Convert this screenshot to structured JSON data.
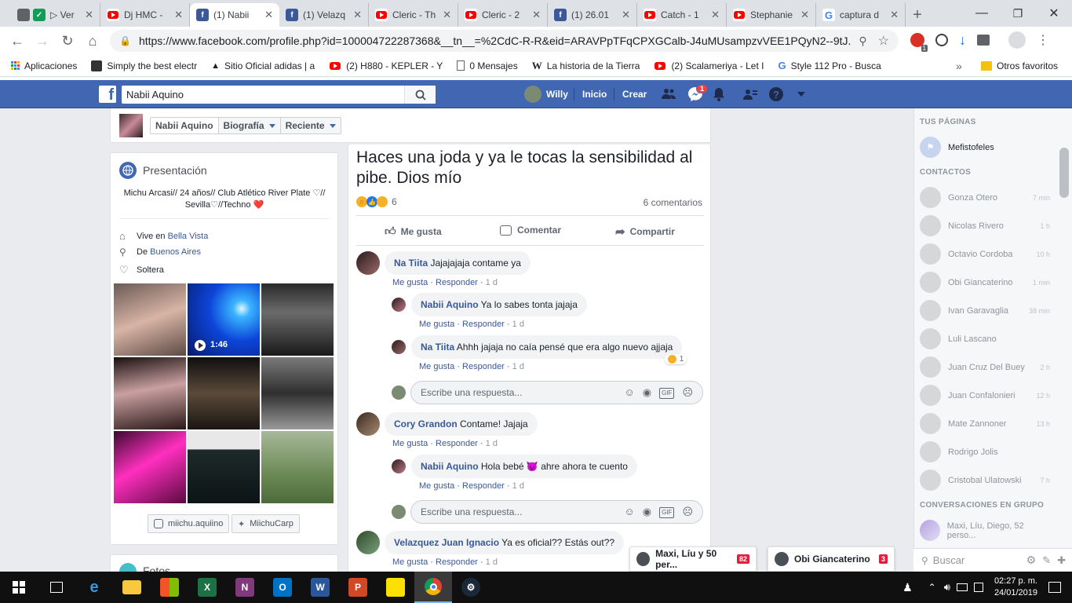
{
  "browser": {
    "tabs": [
      {
        "label": "▷ Ver",
        "icon": "video-icon"
      },
      {
        "label": "Dj HMC - ",
        "icon": "youtube-icon"
      },
      {
        "label": "(1) Nabii",
        "icon": "facebook-icon",
        "active": true
      },
      {
        "label": "(1) Velazq",
        "icon": "facebook-icon"
      },
      {
        "label": "Cleric - Th",
        "icon": "youtube-icon"
      },
      {
        "label": "Cleric - 2",
        "icon": "youtube-icon"
      },
      {
        "label": "(1) 26.01",
        "icon": "facebook-icon"
      },
      {
        "label": "Catch - 1",
        "icon": "youtube-icon"
      },
      {
        "label": "Stephanie",
        "icon": "youtube-icon"
      },
      {
        "label": "captura d",
        "icon": "google-icon"
      }
    ],
    "new_tab": "+",
    "url": "https://www.facebook.com/profile.php?id=100004722287368&__tn__=%2CdC-R-R&eid=ARAVPpTFqCPXGCalb-J4uMUsampzvVEE1PQyN2--9tJ...",
    "bookmarks": [
      {
        "label": "Aplicaciones",
        "icon": "apps-grid-icon"
      },
      {
        "label": "Simply the best electr",
        "icon": "page-icon"
      },
      {
        "label": "Sitio Oficial adidas | a",
        "icon": "adidas-icon"
      },
      {
        "label": "(2) H880 - KEPLER - Y",
        "icon": "youtube-icon"
      },
      {
        "label": "0 Mensajes",
        "icon": "doc-icon"
      },
      {
        "label": "La historia de la Tierra",
        "icon": "wikipedia-icon"
      },
      {
        "label": "(2) Scalameriya - Let I",
        "icon": "youtube-icon"
      },
      {
        "label": "Style 112 Pro - Busca",
        "icon": "google-icon"
      }
    ],
    "bookmarks_more": "»",
    "other_bookmarks": "Otros favoritos",
    "ext_badge": "1"
  },
  "fb": {
    "search_value": "Nabii Aquino",
    "user": "Willy",
    "home": "Inicio",
    "create": "Crear",
    "notif_count": "1"
  },
  "profile": {
    "name": "Nabii Aquino",
    "tab_bio": "Biografía",
    "tab_recent": "Reciente",
    "intro_title": "Presentación",
    "bio": "Michu Arcasi// 24 años// Club Atlético River Plate ♡// Sevilla♡//Techno ❤️",
    "lives_prefix": "Vive en",
    "lives_place": "Bella Vista",
    "from_prefix": "De",
    "from_place": "Buenos Aires",
    "status": "Soltera",
    "video_duration": "1:46",
    "instagram": "miichu.aquiino",
    "twitter": "MiichuCarp",
    "photos_title": "Fotos"
  },
  "post": {
    "text": "Haces una joda y ya le tocas la sensibilidad al pibe. Dios mío",
    "reaction_count": "6",
    "comments_count": "6 comentarios",
    "like": "Me gusta",
    "comment": "Comentar",
    "share": "Compartir",
    "reply_placeholder": "Escribe una respuesta...",
    "meta_like": "Me gusta",
    "meta_reply": "Responder",
    "comments": [
      {
        "name": "Na Tiita",
        "text": "Jajajajaja contame ya",
        "time": "1 d"
      },
      {
        "name": "Nabii Aquino",
        "text": "Ya lo sabes tonta jajaja",
        "time": "1 d"
      },
      {
        "name": "Na Tiita",
        "text": "Ahhh jajaja no caía pensé que era algo nuevo ajjaja",
        "time": "1 d",
        "reactions": "1"
      },
      {
        "name": "Cory Grandon",
        "text": "Contame! Jajaja",
        "time": "1 d"
      },
      {
        "name": "Nabii Aquino",
        "text": "Hola bebé 😈 ahre ahora te cuento",
        "time": "1 d"
      },
      {
        "name": "Velazquez Juan Ignacio",
        "text": "Ya es oficial?? Estás out??",
        "time": "1 d"
      }
    ]
  },
  "sidebar": {
    "pages_title": "TUS PÁGINAS",
    "page_name": "Mefistofeles",
    "contacts_title": "CONTACTOS",
    "contacts": [
      {
        "name": "Gonza Otero",
        "time": "7 min"
      },
      {
        "name": "Nicolas Rivero",
        "time": "1 h"
      },
      {
        "name": "Octavio Cordoba",
        "time": "10 h"
      },
      {
        "name": "Obi Giancaterino",
        "time": "1 min"
      },
      {
        "name": "Ivan Garavaglia",
        "time": "38 min"
      },
      {
        "name": "Luli Lascano",
        "time": ""
      },
      {
        "name": "Juan Cruz Del Buey",
        "time": "2 h"
      },
      {
        "name": "Juan Confalonieri",
        "time": "12 h"
      },
      {
        "name": "Mate Zannoner",
        "time": "13 h"
      },
      {
        "name": "Rodrigo Jolis",
        "time": ""
      },
      {
        "name": "Cristobal Ulatowski",
        "time": "7 h"
      }
    ],
    "groups_title": "CONVERSACIONES EN GRUPO",
    "group_name": "Maxi, Líu, Diego, 52 perso...",
    "search_placeholder": "Buscar"
  },
  "chats": [
    {
      "name": "Maxi, Líu y 50 per...",
      "badge": "82"
    },
    {
      "name": "Obi Giancaterino",
      "badge": "3"
    }
  ],
  "taskbar": {
    "time": "02:27 p. m.",
    "date": "24/01/2019"
  }
}
